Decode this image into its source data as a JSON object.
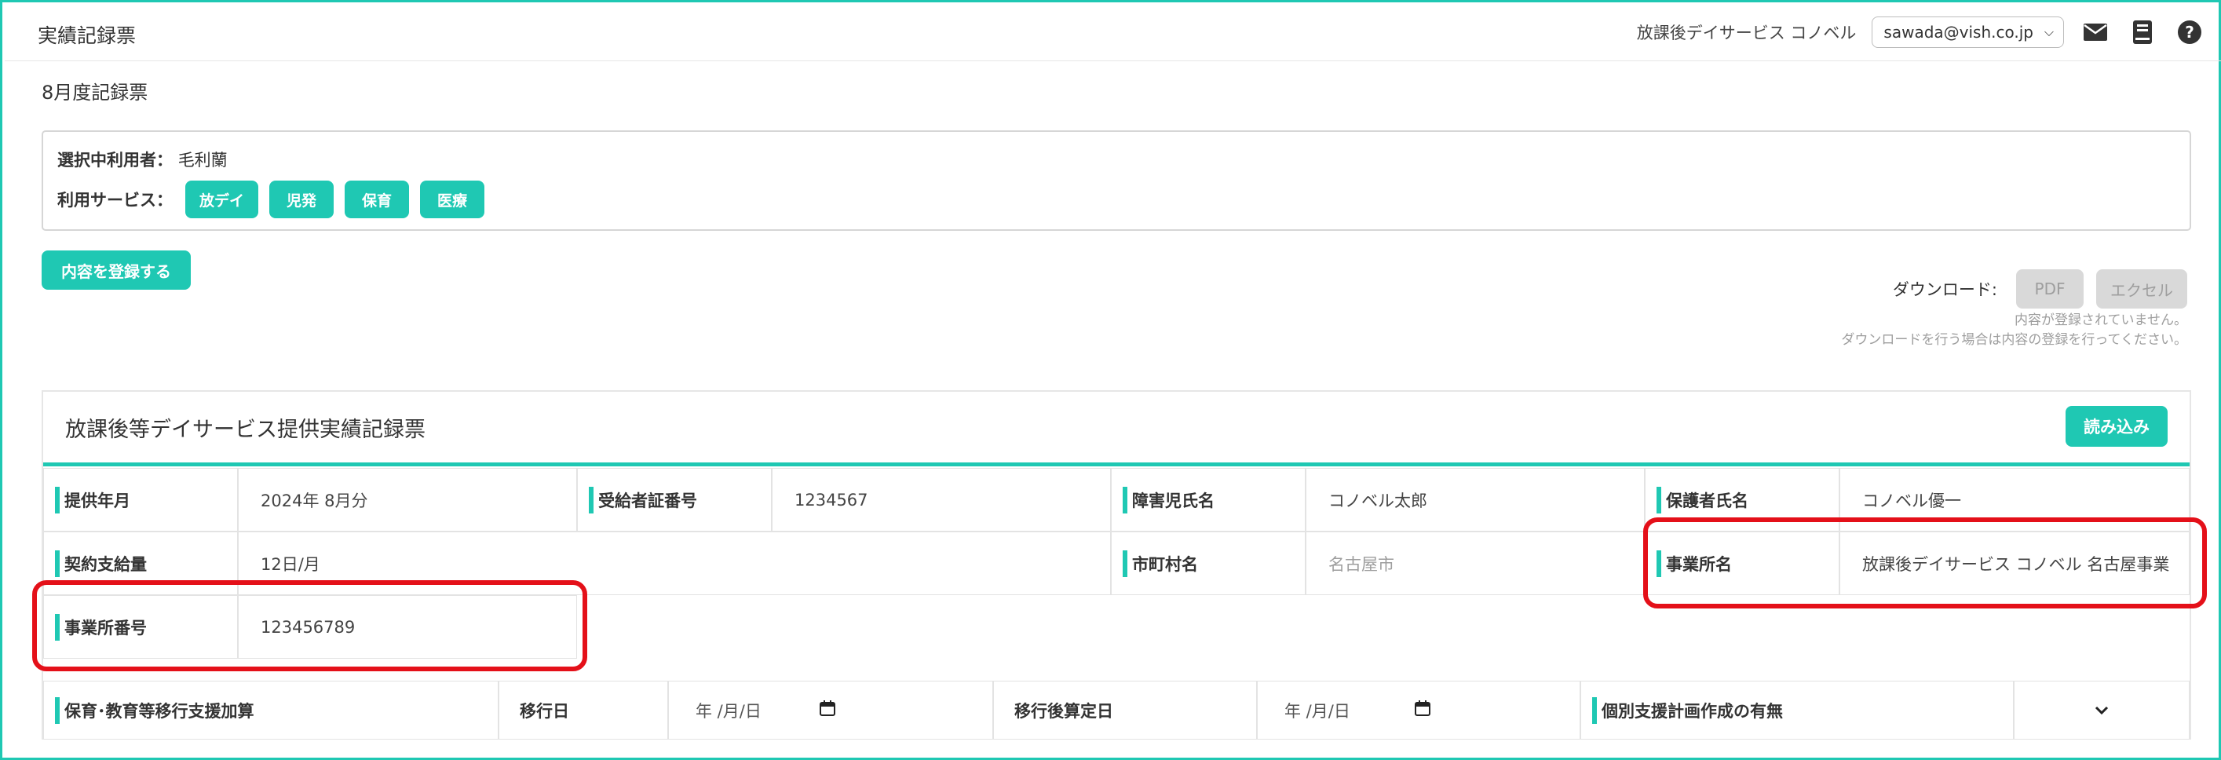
{
  "header": {
    "title": "実績記録票",
    "facility": "放課後デイサービス コノベル",
    "user_email": "sawada@vish.co.jp",
    "icons": [
      "mail-icon",
      "book-icon",
      "help-icon"
    ]
  },
  "page": {
    "subtitle": "8月度記録票"
  },
  "user_box": {
    "selected_label": "選択中利用者：",
    "selected_value": "毛利蘭",
    "services_label": "利用サービス：",
    "services": [
      "放デイ",
      "児発",
      "保育",
      "医療"
    ]
  },
  "register_button": "内容を登録する",
  "download": {
    "label": "ダウンロード:",
    "pdf": "PDF",
    "excel": "エクセル",
    "note_line1": "内容が登録されていません。",
    "note_line2": "ダウンロードを行う場合は内容の登録を行ってください。"
  },
  "sheet": {
    "title": "放課後等デイサービス提供実績記録票",
    "read_button": "読み込み",
    "fields": {
      "year_month_label": "提供年月",
      "year_month_value": "2024年 8月分",
      "recipient_no_label": "受給者証番号",
      "recipient_no_value": "1234567",
      "child_name_label": "障害児氏名",
      "child_name_value": "コノベル太郎",
      "guardian_label": "保護者氏名",
      "guardian_value": "コノベル優一",
      "contract_label": "契約支給量",
      "contract_value": "12日/月",
      "city_label": "市町村名",
      "city_value": "名古屋市",
      "office_name_label": "事業所名",
      "office_name_value": "放課後デイサービス コノベル 名古屋事業",
      "office_no_label": "事業所番号",
      "office_no_value": "123456789",
      "transition_label": "保育･教育等移行支援加算",
      "transition_date_label": "移行日",
      "transition_date_value": "年 /月/日",
      "post_calc_label": "移行後算定日",
      "post_calc_value": "年 /月/日",
      "plan_label": "個別支援計画作成の有無"
    }
  },
  "colors": {
    "accent": "#1fc8b3",
    "highlight": "#e41019",
    "disabled": "#d9d9d9"
  }
}
